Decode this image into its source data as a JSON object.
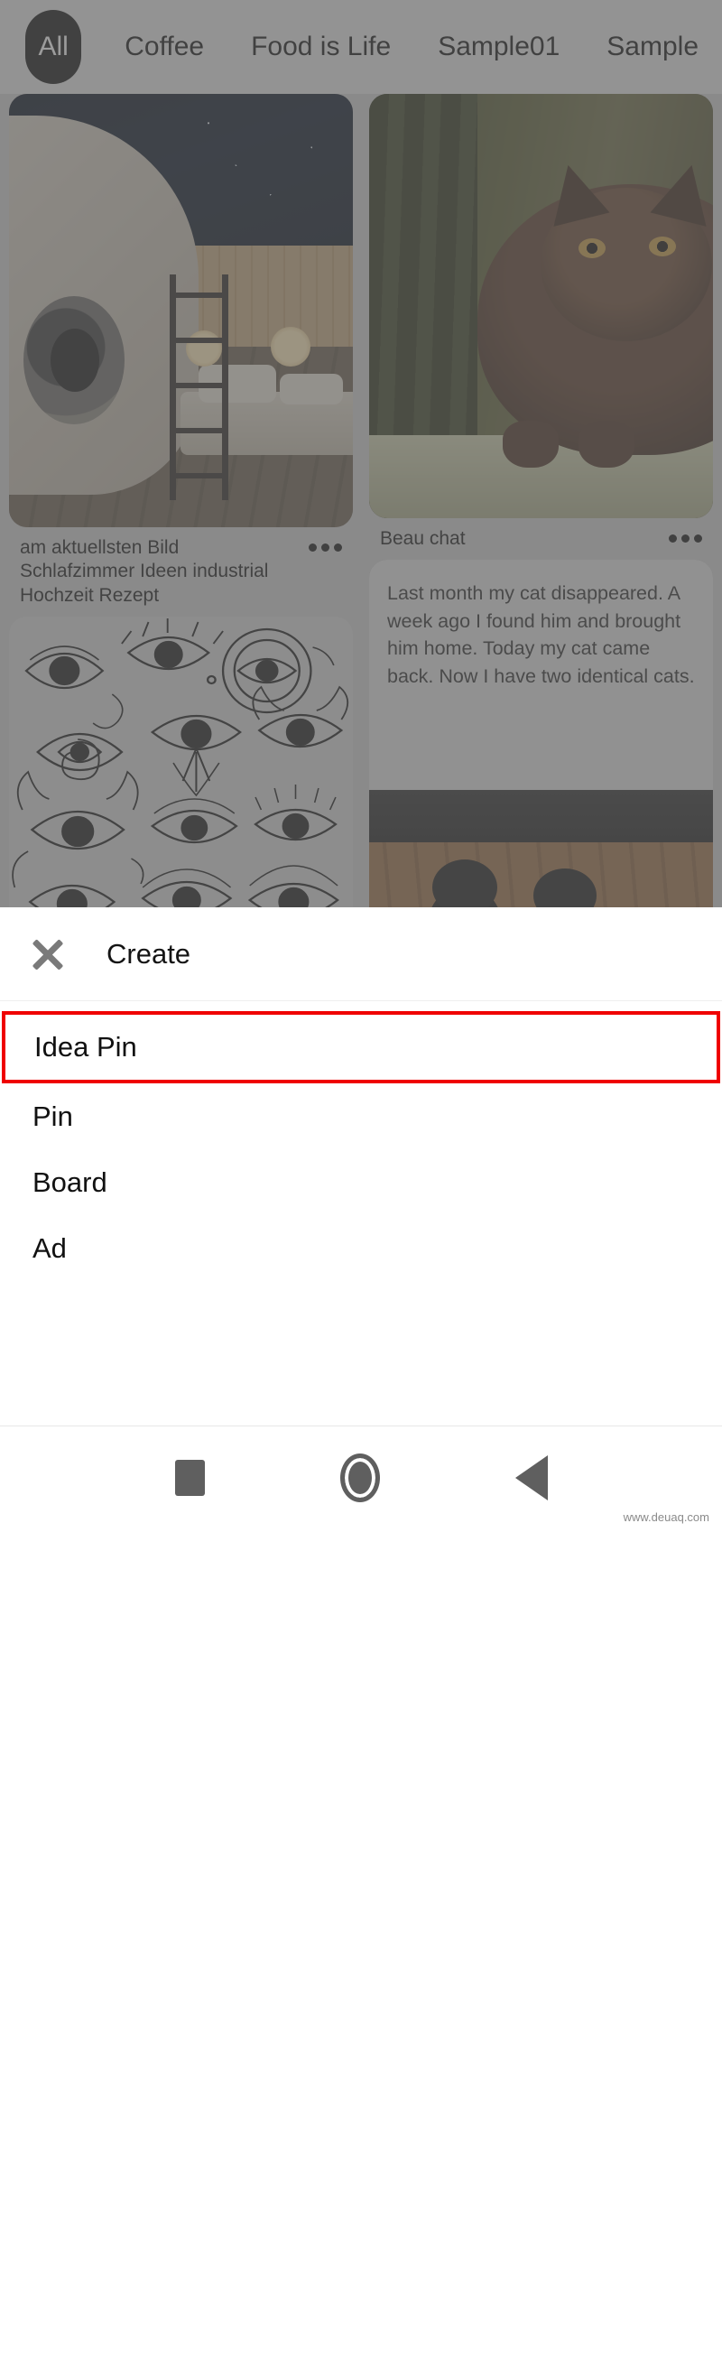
{
  "app": {
    "filter_chips": [
      {
        "label": "All",
        "active": true
      },
      {
        "label": "Coffee",
        "active": false
      },
      {
        "label": "Food is Life",
        "active": false
      },
      {
        "label": "Sample01",
        "active": false
      },
      {
        "label": "Sample",
        "active": false
      }
    ],
    "pins": [
      {
        "id": "pin-bedroom",
        "title": "am aktuellsten Bild Schlafzimmer Ideen industrial Hochzeit Rezept",
        "overflow_label": "•••",
        "column": "left",
        "art": "bedroom-render"
      },
      {
        "id": "pin-cat",
        "title": "Beau chat",
        "overflow_label": "•••",
        "column": "right",
        "art": "brown-cat-photo"
      },
      {
        "id": "pin-eyes",
        "title": "",
        "overflow_label": "",
        "column": "left",
        "art": "eye-sketches"
      },
      {
        "id": "pin-cats-text",
        "title": "",
        "overflow_label": "",
        "column": "right",
        "art": "two-cats-photo",
        "screenshot_text": "Last month my cat disappeared.  A week ago I found him and brought him home.  Today my cat came back.  Now I have two identical cats."
      }
    ]
  },
  "create_sheet": {
    "close_icon": "close-icon",
    "title": "Create",
    "items": [
      {
        "label": "Idea Pin",
        "highlighted": true
      },
      {
        "label": "Pin",
        "highlighted": false
      },
      {
        "label": "Board",
        "highlighted": false
      },
      {
        "label": "Ad",
        "highlighted": false
      }
    ],
    "highlight_color": "#ef0000"
  },
  "android_nav": {
    "recents_label": "recent-apps",
    "home_label": "home",
    "back_label": "back"
  },
  "watermark": "www.deuaq.com"
}
